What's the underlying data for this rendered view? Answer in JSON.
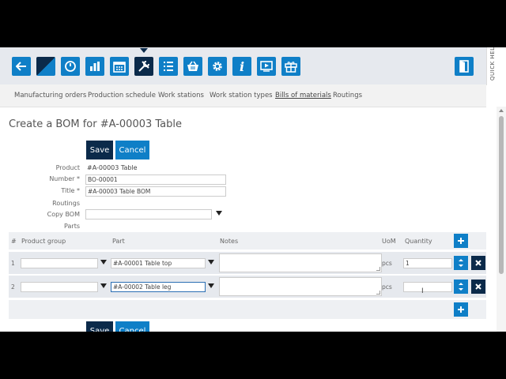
{
  "toolbar": {
    "buttons": [
      {
        "icon": "back-arrow-icon"
      },
      {
        "icon": "logo-icon"
      },
      {
        "icon": "speedometer-icon"
      },
      {
        "icon": "bar-chart-icon"
      },
      {
        "icon": "calendar-icon"
      },
      {
        "icon": "tools-icon",
        "active": true
      },
      {
        "icon": "list-icon"
      },
      {
        "icon": "basket-icon"
      },
      {
        "icon": "gear-icon"
      },
      {
        "icon": "info-icon"
      },
      {
        "icon": "play-screen-icon"
      },
      {
        "icon": "gift-icon"
      },
      {
        "icon": "exit-door-icon"
      }
    ],
    "quick_help": "QUICK HELP",
    "accent_color": "#0f7fc7",
    "active_color": "#0b2a4a"
  },
  "nav": {
    "items": [
      {
        "label": "Manufacturing orders"
      },
      {
        "label": "Production schedule"
      },
      {
        "label": "Work stations"
      },
      {
        "label": "Work station types"
      },
      {
        "label": "Bills of materials",
        "current": true
      },
      {
        "label": "Routings"
      }
    ]
  },
  "page": {
    "title": "Create a BOM for #A-00003 Table"
  },
  "actions": {
    "save_label": "Save",
    "cancel_label": "Cancel"
  },
  "form": {
    "product_label": "Product",
    "product_value": "#A-00003 Table",
    "number_label": "Number *",
    "number_value": "BO-00001",
    "title_label": "Title *",
    "title_value": "#A-00003 Table BOM",
    "routings_label": "Routings",
    "copy_bom_label": "Copy BOM",
    "copy_bom_value": "",
    "parts_label": "Parts"
  },
  "parts_table": {
    "headers": {
      "num": "#",
      "product_group": "Product group",
      "part": "Part",
      "notes": "Notes",
      "uom": "UoM",
      "quantity": "Quantity"
    },
    "rows": [
      {
        "num": "1",
        "product_group": "",
        "part": "#A-00001 Table top",
        "notes": "",
        "uom": "pcs",
        "quantity": "1"
      },
      {
        "num": "2",
        "product_group": "",
        "part": "#A-00002 Table leg",
        "notes": "",
        "uom": "pcs",
        "quantity": ""
      }
    ]
  }
}
